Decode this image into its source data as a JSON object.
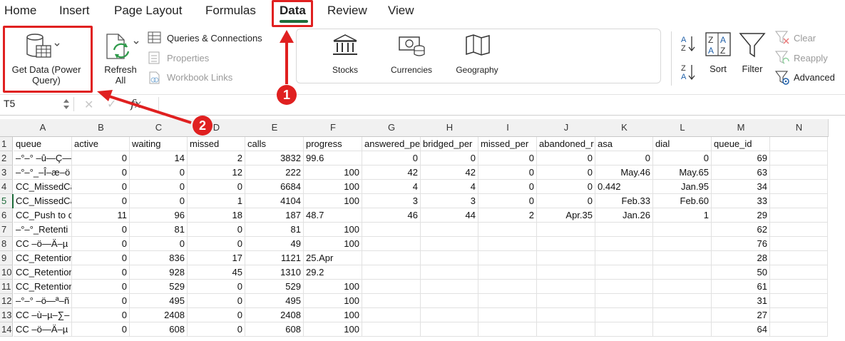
{
  "tabs": [
    {
      "label": "Home"
    },
    {
      "label": "Insert"
    },
    {
      "label": "Page Layout"
    },
    {
      "label": "Formulas"
    },
    {
      "label": "Data"
    },
    {
      "label": "Review"
    },
    {
      "label": "View"
    }
  ],
  "ribbon": {
    "get_data": "Get Data (Power\nQuery)",
    "refresh_all": "Refresh\nAll",
    "queries_connections": "Queries & Connections",
    "properties": "Properties",
    "workbook_links": "Workbook Links",
    "stocks": "Stocks",
    "currencies": "Currencies",
    "geography": "Geography",
    "sort": "Sort",
    "filter": "Filter",
    "clear": "Clear",
    "reapply": "Reapply",
    "advanced": "Advanced"
  },
  "formula_bar": {
    "name_box": "T5",
    "fx": "fx"
  },
  "annotations": {
    "badge1": "1",
    "badge2": "2",
    "color": "#e02020"
  },
  "sheet": {
    "columns": [
      "A",
      "B",
      "C",
      "D",
      "E",
      "F",
      "G",
      "H",
      "I",
      "J",
      "K",
      "L",
      "M",
      "N"
    ],
    "row_numbers": [
      "1",
      "2",
      "3",
      "4",
      "5",
      "6",
      "7",
      "8",
      "9",
      "10",
      "11",
      "12",
      "13",
      "14"
    ],
    "selected_row": "5",
    "rows": [
      [
        "queue",
        "active",
        "waiting",
        "missed",
        "calls",
        "progress",
        "answered_pe",
        "bridged_per",
        "missed_per",
        "abandoned_r",
        "asa",
        "dial",
        "queue_id",
        ""
      ],
      [
        "–°–° –û—Ç—á",
        "0",
        "14",
        "2",
        "3832",
        "99.6",
        "0",
        "0",
        "0",
        "0",
        "0",
        "0",
        "69",
        ""
      ],
      [
        "–°–°_–Î–æ–ö",
        "0",
        "0",
        "12",
        "222",
        "100",
        "42",
        "42",
        "0",
        "0",
        "May.46",
        "May.65",
        "63",
        ""
      ],
      [
        "CC_MissedCa",
        "0",
        "0",
        "0",
        "6684",
        "100",
        "4",
        "4",
        "0",
        "0",
        "0.442",
        "Jan.95",
        "34",
        ""
      ],
      [
        "CC_MissedCa",
        "0",
        "0",
        "1",
        "4104",
        "100",
        "3",
        "3",
        "0",
        "0",
        "Feb.33",
        "Feb.60",
        "33",
        ""
      ],
      [
        "CC_Push to d",
        "11",
        "96",
        "18",
        "187",
        "48.7",
        "46",
        "44",
        "2",
        "Apr.35",
        "Jan.26",
        "1",
        "29",
        ""
      ],
      [
        "–°–°_Retenti",
        "0",
        "81",
        "0",
        "81",
        "100",
        "",
        "",
        "",
        "",
        "",
        "",
        "62",
        ""
      ],
      [
        "CC –ö—Ä–µ",
        "0",
        "0",
        "0",
        "49",
        "100",
        "",
        "",
        "",
        "",
        "",
        "",
        "76",
        ""
      ],
      [
        "CC_Retention",
        "0",
        "836",
        "17",
        "1121",
        "25.Apr",
        "",
        "",
        "",
        "",
        "",
        "",
        "28",
        ""
      ],
      [
        "CC_Retention",
        "0",
        "928",
        "45",
        "1310",
        "29.2",
        "",
        "",
        "",
        "",
        "",
        "",
        "50",
        ""
      ],
      [
        "CC_Retention",
        "0",
        "529",
        "0",
        "529",
        "100",
        "",
        "",
        "",
        "",
        "",
        "",
        "61",
        ""
      ],
      [
        "–°–° –ö—ª–ñ",
        "0",
        "495",
        "0",
        "495",
        "100",
        "",
        "",
        "",
        "",
        "",
        "",
        "31",
        ""
      ],
      [
        "CC –ù–µ–∑–",
        "0",
        "2408",
        "0",
        "2408",
        "100",
        "",
        "",
        "",
        "",
        "",
        "",
        "27",
        ""
      ],
      [
        "CC –ö—Ä–µ",
        "0",
        "608",
        "0",
        "608",
        "100",
        "",
        "",
        "",
        "",
        "",
        "",
        "64",
        ""
      ]
    ]
  }
}
